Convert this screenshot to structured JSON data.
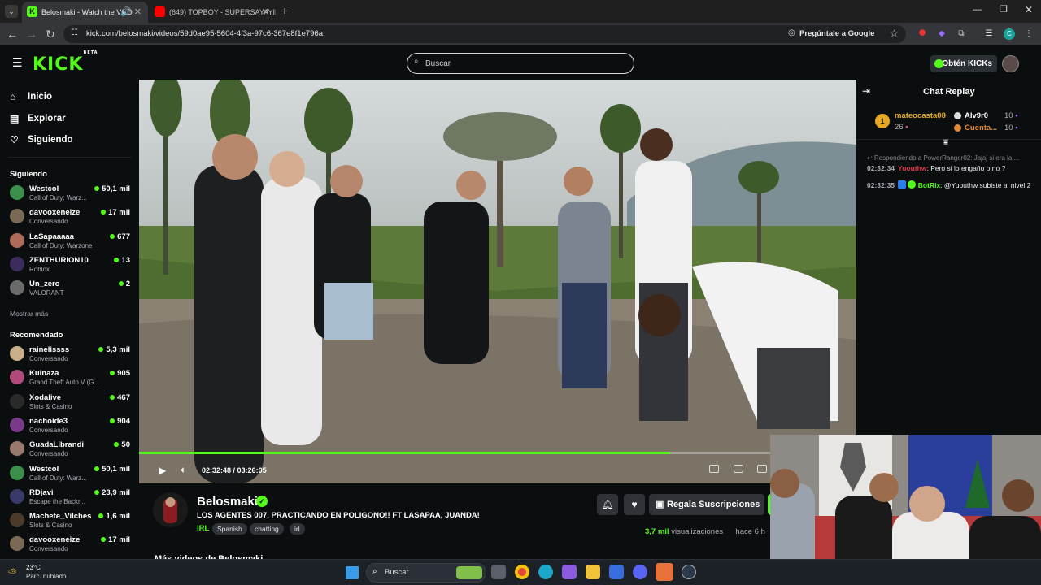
{
  "browser": {
    "tabs": [
      {
        "label": "Belosmaki - Watch the VOD",
        "active": true
      },
      {
        "label": "(649) TOPBOY - SUPERSAYAYIN",
        "active": false
      }
    ],
    "url": "kick.com/belosmaki/videos/59d0ae95-5604-4f3a-97c6-367e8f1e796a",
    "ask_google": "Pregúntale a Google"
  },
  "header": {
    "logo": "KICK",
    "logo_badge": "BETA",
    "search_placeholder": "Buscar",
    "get_kicks": "Obtén KICKs"
  },
  "sidebar": {
    "nav": [
      {
        "label": "Inicio",
        "icon": "home-icon"
      },
      {
        "label": "Explorar",
        "icon": "compass-icon"
      },
      {
        "label": "Siguiendo",
        "icon": "heart-icon"
      }
    ],
    "following_title": "Siguiendo",
    "following": [
      {
        "name": "Westcol",
        "category": "Call of Duty: Warz...",
        "viewers": "50,1 mil",
        "color": "#3b8f4a"
      },
      {
        "name": "davooxeneize",
        "category": "Conversando",
        "viewers": "17 mil",
        "color": "#7a6a55"
      },
      {
        "name": "LaSapaaaaa",
        "category": "Call of Duty: Warzone",
        "viewers": "677",
        "color": "#b06a5a"
      },
      {
        "name": "ZENTHURION10",
        "category": "Roblox",
        "viewers": "13",
        "color": "#3c2c5e"
      },
      {
        "name": "Un_zero",
        "category": "VALORANT",
        "viewers": "2",
        "color": "#6b6b6b"
      }
    ],
    "show_more": "Mostrar más",
    "recommended_title": "Recomendado",
    "recommended": [
      {
        "name": "rainelissss",
        "category": "Conversando",
        "viewers": "5,3 mil",
        "color": "#c9b08a"
      },
      {
        "name": "Kuinaza",
        "category": "Grand Theft Auto V (G...",
        "viewers": "905",
        "color": "#b04a7a"
      },
      {
        "name": "Xodalive",
        "category": "Slots & Casino",
        "viewers": "467",
        "color": "#2a2a2a"
      },
      {
        "name": "nachoide3",
        "category": "Conversando",
        "viewers": "904",
        "color": "#7a3a8a"
      },
      {
        "name": "GuadaLibrandi",
        "category": "Conversando",
        "viewers": "50",
        "color": "#9a7a6a"
      },
      {
        "name": "Westcol",
        "category": "Call of Duty: Warz...",
        "viewers": "50,1 mil",
        "color": "#3b8f4a"
      },
      {
        "name": "RDjavi",
        "category": "Escape the Backr...",
        "viewers": "23,9 mil",
        "color": "#3a3a6a"
      },
      {
        "name": "Machete_Vilches",
        "category": "Slots & Casino",
        "viewers": "1,6 mil",
        "color": "#4a3a2a"
      },
      {
        "name": "davooxeneize",
        "category": "Conversando",
        "viewers": "17 mil",
        "color": "#7a6a55"
      }
    ]
  },
  "player": {
    "time_current": "02:32:48",
    "time_total": "03:26:05",
    "progress": 0.74
  },
  "video": {
    "streamer": "Belosmaki",
    "title": "LOS AGENTES 007, PRACTICANDO EN POLIGONO!! FT LASAPAA, JUANDA!",
    "category": "IRL",
    "tags": [
      "Spanish",
      "chatting",
      "irl"
    ],
    "gift_label": "Regala Suscripciones",
    "views": "3,7 mil",
    "views_suffix": "visualizaciones",
    "ago": "hace 6 h",
    "more_videos": "Más videos de Belosmaki"
  },
  "chat": {
    "title": "Chat Replay",
    "gifters": [
      {
        "rank": "1",
        "name": "mateocasta08",
        "count": "26"
      },
      {
        "name": "Alv9r0",
        "count": "10"
      },
      {
        "name": "Cuenta...",
        "count": "10"
      }
    ],
    "reply_to": "Respondiendo a PowerRanger02: Jajaj si era la ...",
    "messages": [
      {
        "time": "02:32:34",
        "user": "Yuouthw",
        "user_color": "#e0374a",
        "text": "Pero si lo engaño o no ?"
      },
      {
        "time": "02:32:35",
        "user": "BotRix",
        "user_color": "#53fc18",
        "text": "@Yuouthw subiste al nivel 2"
      }
    ]
  },
  "taskbar": {
    "temp": "23°C",
    "condition": "Parc. nublado",
    "search_placeholder": "Buscar"
  }
}
